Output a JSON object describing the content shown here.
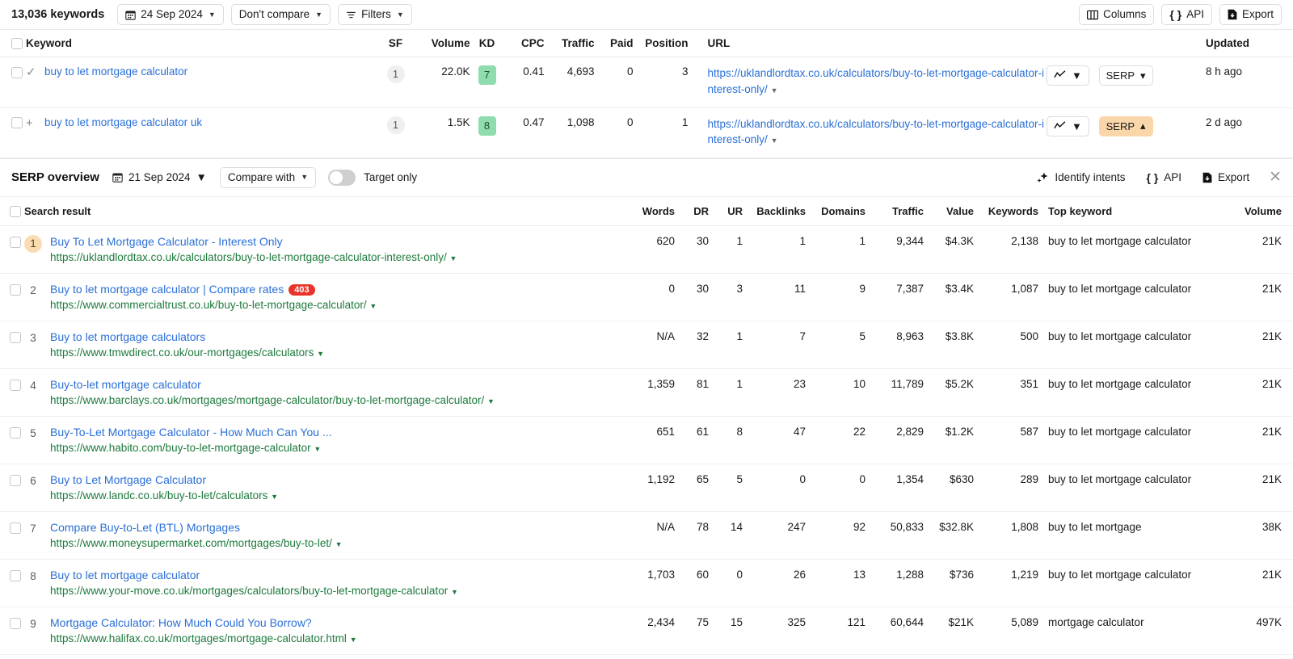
{
  "toolbar": {
    "keyword_count": "13,036 keywords",
    "date_label": "24 Sep 2024",
    "compare_label": "Don't compare",
    "filters_label": "Filters",
    "columns_label": "Columns",
    "api_label": "API",
    "export_label": "Export",
    "calendar_icon": "calendar-icon",
    "filter_icon": "filter-icon",
    "columns_icon": "columns-icon",
    "api_icon": "code-braces-icon",
    "export_icon": "download-file-icon"
  },
  "keyword_table": {
    "headers": {
      "keyword": "Keyword",
      "sf": "SF",
      "volume": "Volume",
      "kd": "KD",
      "cpc": "CPC",
      "traffic": "Traffic",
      "paid": "Paid",
      "position": "Position",
      "url": "URL",
      "updated": "Updated"
    },
    "rows": [
      {
        "mark": "✓",
        "keyword": "buy to let mortgage calculator",
        "sf": "1",
        "volume": "22.0K",
        "kd": "7",
        "cpc": "0.41",
        "traffic": "4,693",
        "paid": "0",
        "position": "3",
        "url": "https://uklandlordtax.co.uk/calculators/buy-to-let-mortgage-calculator-interest-only/",
        "serp_label": "SERP",
        "serp_caret": "▾",
        "serp_highlight": false,
        "updated": "8 h ago"
      },
      {
        "mark": "+",
        "keyword": "buy to let mortgage calculator uk",
        "sf": "1",
        "volume": "1.5K",
        "kd": "8",
        "cpc": "0.47",
        "traffic": "1,098",
        "paid": "0",
        "position": "1",
        "url": "https://uklandlordtax.co.uk/calculators/buy-to-let-mortgage-calculator-interest-only/",
        "serp_label": "SERP",
        "serp_caret": "▴",
        "serp_highlight": true,
        "updated": "2 d ago"
      }
    ]
  },
  "serp_overview": {
    "title": "SERP overview",
    "date_label": "21 Sep 2024",
    "compare_label": "Compare with",
    "toggle_label": "Target only",
    "toggle_on": false,
    "identify_intents_label": "Identify intents",
    "api_label": "API",
    "export_label": "Export",
    "close_label": "✕",
    "sparkle_icon": "sparkles-icon",
    "headers": {
      "search_result": "Search result",
      "words": "Words",
      "dr": "DR",
      "ur": "UR",
      "backlinks": "Backlinks",
      "domains": "Domains",
      "traffic": "Traffic",
      "value": "Value",
      "keywords": "Keywords",
      "top_keyword": "Top keyword",
      "volume": "Volume"
    },
    "rows": [
      {
        "rank": "1",
        "rank_badge": true,
        "title": "Buy To Let Mortgage Calculator - Interest Only",
        "status_code": "",
        "url": "https://uklandlordtax.co.uk/calculators/buy-to-let-mortgage-calculator-interest-only/",
        "words": "620",
        "dr": "30",
        "ur": "1",
        "backlinks": "1",
        "domains": "1",
        "traffic": "9,344",
        "value": "$4.3K",
        "keywords": "2,138",
        "top_keyword": "buy to let mortgage calculator",
        "volume": "21K"
      },
      {
        "rank": "2",
        "rank_badge": false,
        "title": "Buy to let mortgage calculator | Compare rates",
        "status_code": "403",
        "url": "https://www.commercialtrust.co.uk/buy-to-let-mortgage-calculator/",
        "words": "0",
        "dr": "30",
        "ur": "3",
        "backlinks": "11",
        "domains": "9",
        "traffic": "7,387",
        "value": "$3.4K",
        "keywords": "1,087",
        "top_keyword": "buy to let mortgage calculator",
        "volume": "21K"
      },
      {
        "rank": "3",
        "rank_badge": false,
        "title": "Buy to let mortgage calculators",
        "status_code": "",
        "url": "https://www.tmwdirect.co.uk/our-mortgages/calculators",
        "words": "N/A",
        "dr": "32",
        "ur": "1",
        "backlinks": "7",
        "domains": "5",
        "traffic": "8,963",
        "value": "$3.8K",
        "keywords": "500",
        "top_keyword": "buy to let mortgage calculator",
        "volume": "21K"
      },
      {
        "rank": "4",
        "rank_badge": false,
        "title": "Buy-to-let mortgage calculator",
        "status_code": "",
        "url": "https://www.barclays.co.uk/mortgages/mortgage-calculator/buy-to-let-mortgage-calculator/",
        "words": "1,359",
        "dr": "81",
        "ur": "1",
        "backlinks": "23",
        "domains": "10",
        "traffic": "11,789",
        "value": "$5.2K",
        "keywords": "351",
        "top_keyword": "buy to let mortgage calculator",
        "volume": "21K"
      },
      {
        "rank": "5",
        "rank_badge": false,
        "title": "Buy-To-Let Mortgage Calculator - How Much Can You ...",
        "status_code": "",
        "url": "https://www.habito.com/buy-to-let-mortgage-calculator",
        "words": "651",
        "dr": "61",
        "ur": "8",
        "backlinks": "47",
        "domains": "22",
        "traffic": "2,829",
        "value": "$1.2K",
        "keywords": "587",
        "top_keyword": "buy to let mortgage calculator",
        "volume": "21K"
      },
      {
        "rank": "6",
        "rank_badge": false,
        "title": "Buy to Let Mortgage Calculator",
        "status_code": "",
        "url": "https://www.landc.co.uk/buy-to-let/calculators",
        "words": "1,192",
        "dr": "65",
        "ur": "5",
        "backlinks": "0",
        "domains": "0",
        "traffic": "1,354",
        "value": "$630",
        "keywords": "289",
        "top_keyword": "buy to let mortgage calculator",
        "volume": "21K"
      },
      {
        "rank": "7",
        "rank_badge": false,
        "title": "Compare Buy-to-Let (BTL) Mortgages",
        "status_code": "",
        "url": "https://www.moneysupermarket.com/mortgages/buy-to-let/",
        "words": "N/A",
        "dr": "78",
        "ur": "14",
        "backlinks": "247",
        "domains": "92",
        "traffic": "50,833",
        "value": "$32.8K",
        "keywords": "1,808",
        "top_keyword": "buy to let mortgage",
        "volume": "38K"
      },
      {
        "rank": "8",
        "rank_badge": false,
        "title": "Buy to let mortgage calculator",
        "status_code": "",
        "url": "https://www.your-move.co.uk/mortgages/calculators/buy-to-let-mortgage-calculator",
        "words": "1,703",
        "dr": "60",
        "ur": "0",
        "backlinks": "26",
        "domains": "13",
        "traffic": "1,288",
        "value": "$736",
        "keywords": "1,219",
        "top_keyword": "buy to let mortgage calculator",
        "volume": "21K"
      },
      {
        "rank": "9",
        "rank_badge": false,
        "title": "Mortgage Calculator: How Much Could You Borrow?",
        "status_code": "",
        "url": "https://www.halifax.co.uk/mortgages/mortgage-calculator.html",
        "words": "2,434",
        "dr": "75",
        "ur": "15",
        "backlinks": "325",
        "domains": "121",
        "traffic": "60,644",
        "value": "$21K",
        "keywords": "5,089",
        "top_keyword": "mortgage calculator",
        "volume": "497K"
      }
    ]
  },
  "colors": {
    "link_blue": "#2a6fd6",
    "url_green": "#1d7a3c",
    "kd_green": "#8fdcae",
    "highlight_orange": "#fad6ab",
    "status_red": "#e8342a"
  }
}
